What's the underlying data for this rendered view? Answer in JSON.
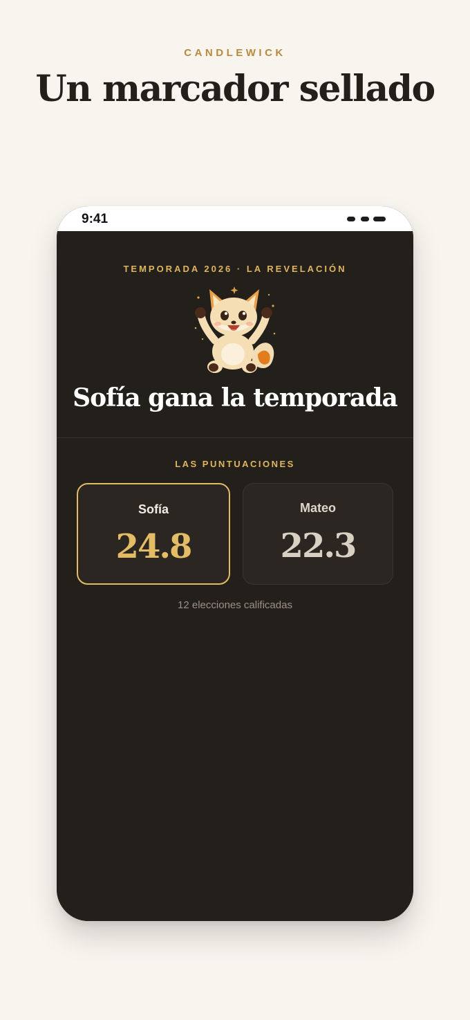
{
  "header": {
    "brand": "CANDLEWICK",
    "headline": "Un marcador sellado"
  },
  "status_bar": {
    "time": "9:41"
  },
  "reveal": {
    "eyebrow": "TEMPORADA 2026 · LA REVELACIÓN",
    "mascot": "celebrating-fox-icon",
    "winner_title": "Sofía gana la temporada"
  },
  "scores": {
    "label": "LAS PUNTUACIONES",
    "players": [
      {
        "name": "Sofía",
        "score": "24.8",
        "is_winner": true
      },
      {
        "name": "Mateo",
        "score": "22.3",
        "is_winner": false
      }
    ],
    "footnote": "12 elecciones calificadas"
  },
  "colors": {
    "page_background": "#f8f5ef",
    "brand_gold": "#b98a3e",
    "screen_background": "#231f1b",
    "accent_gold": "#e5bc66",
    "card_background": "#2b2621"
  }
}
